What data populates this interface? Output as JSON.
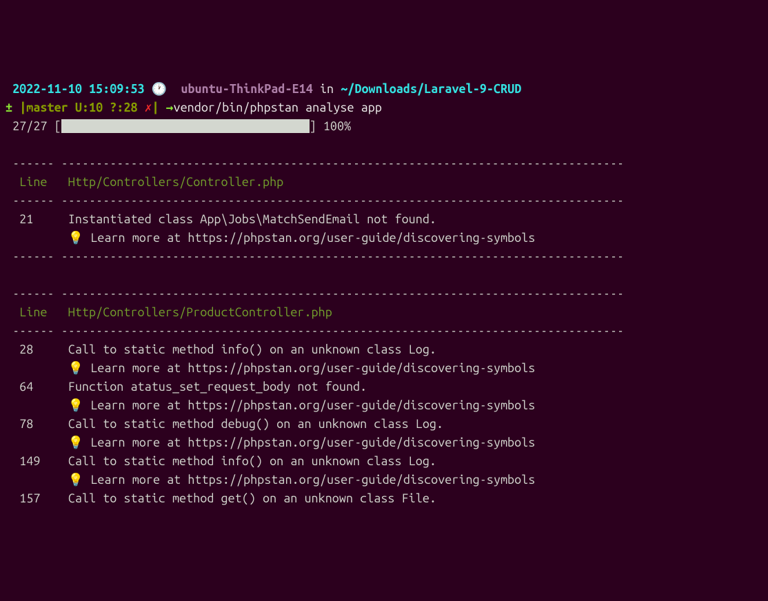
{
  "prompt": {
    "datetime": "2022-11-10 15:09:53",
    "clock": "🕐",
    "host": "ubuntu-ThinkPad-E14",
    "in": "in",
    "path": "~/Downloads/Laravel-9-CRUD",
    "gitprefix": "±",
    "branch": "|master U:10 ?:28",
    "xmark": "✗",
    "pipe": "|",
    "arrow": "→",
    "command": "vendor/bin/phpstan analyse app"
  },
  "progress": {
    "count": "27/27",
    "percent": "100%"
  },
  "dashes": {
    "left": " ------ ",
    "right": "--------------------------------------------------------------------------------- "
  },
  "table1": {
    "line_header": "Line",
    "file": "Http/Controllers/Controller.php",
    "rows": [
      {
        "num": "21",
        "msg": "Instantiated class App\\Jobs\\MatchSendEmail not found.",
        "learn": "💡 Learn more at https://phpstan.org/user-guide/discovering-symbols"
      }
    ]
  },
  "table2": {
    "line_header": "Line",
    "file": "Http/Controllers/ProductController.php",
    "rows": [
      {
        "num": "28",
        "msg": "Call to static method info() on an unknown class Log.",
        "learn": "💡 Learn more at https://phpstan.org/user-guide/discovering-symbols"
      },
      {
        "num": "64",
        "msg": "Function atatus_set_request_body not found.",
        "learn": "💡 Learn more at https://phpstan.org/user-guide/discovering-symbols"
      },
      {
        "num": "78",
        "msg": "Call to static method debug() on an unknown class Log.",
        "learn": "💡 Learn more at https://phpstan.org/user-guide/discovering-symbols"
      },
      {
        "num": "149",
        "msg": "Call to static method info() on an unknown class Log.",
        "learn": "💡 Learn more at https://phpstan.org/user-guide/discovering-symbols"
      },
      {
        "num": "157",
        "msg": "Call to static method get() on an unknown class File."
      }
    ]
  }
}
